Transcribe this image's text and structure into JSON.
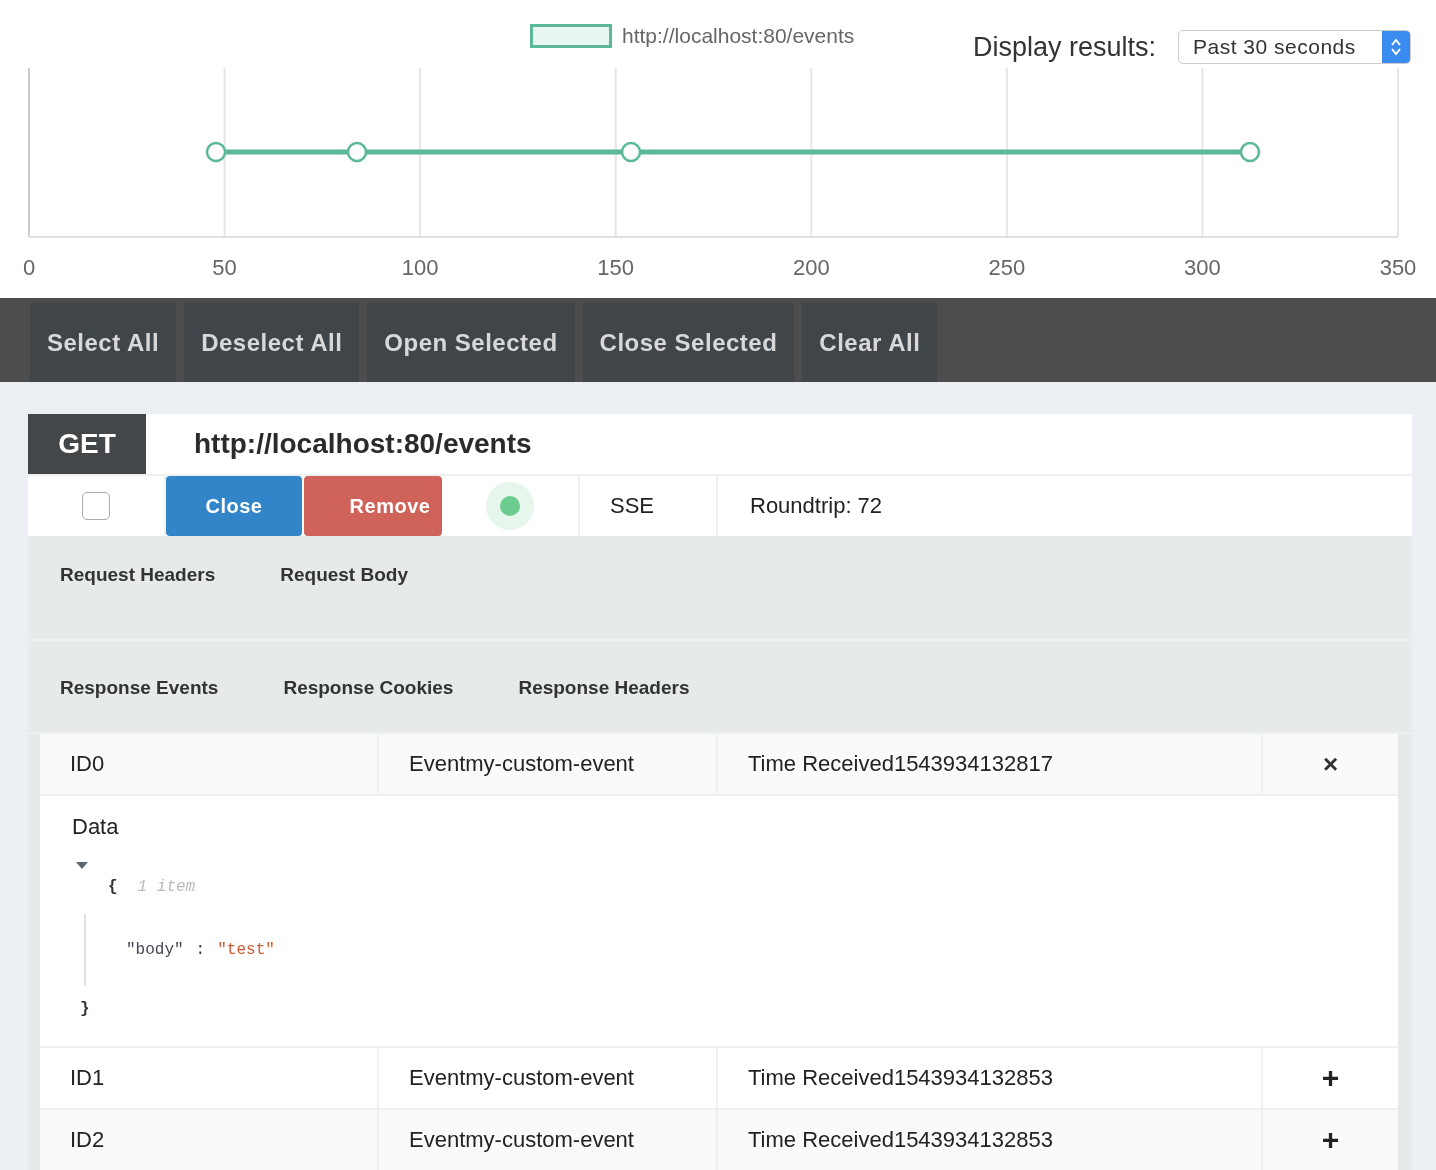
{
  "chart": {
    "display_label": "Display results:",
    "range_select": "Past 30 seconds",
    "legend": "http://localhost:80/events",
    "axis_labels": [
      "0",
      "50",
      "100",
      "150",
      "200",
      "250",
      "300",
      "350"
    ]
  },
  "toolbar": [
    "Select All",
    "Deselect All",
    "Open Selected",
    "Close Selected",
    "Clear All"
  ],
  "request": {
    "method": "GET",
    "url": "http://localhost:80/events",
    "checked": false,
    "close_button": "Close",
    "remove_button": "Remove",
    "connected": true,
    "protocol": "SSE",
    "roundtrip": "Roundtrip: 72",
    "request_tabs": [
      "Request Headers",
      "Request Body"
    ],
    "response_tabs": [
      "Response Events",
      "Response Cookies",
      "Response Headers"
    ],
    "events": [
      {
        "id": "ID0",
        "event": "Eventmy-custom-event",
        "time": "Time Received1543934132817",
        "expanded": true,
        "toggle": "×",
        "data_label": "Data",
        "json_open": "{",
        "json_count": "1 item",
        "json_key": "\"body\"",
        "json_sep": ":",
        "json_value": "\"test\"",
        "json_close": "}"
      },
      {
        "id": "ID1",
        "event": "Eventmy-custom-event",
        "time": "Time Received1543934132853",
        "expanded": false,
        "toggle": "+"
      },
      {
        "id": "ID2",
        "event": "Eventmy-custom-event",
        "time": "Time Received1543934132853",
        "expanded": false,
        "toggle": "+"
      }
    ]
  }
}
